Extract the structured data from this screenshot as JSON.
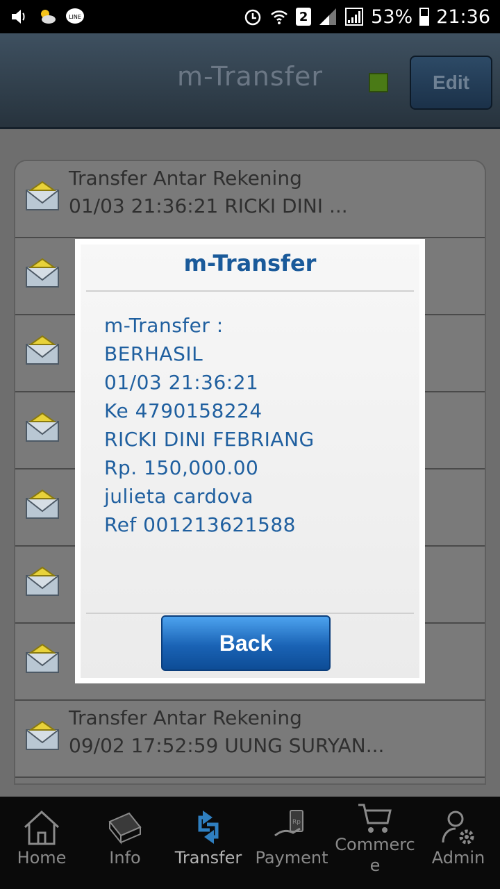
{
  "status_bar": {
    "sim_slot": "2",
    "battery": "53%",
    "time": "21:36",
    "icons": [
      "volume-icon",
      "weather-icon",
      "line-app-icon",
      "alarm-icon",
      "wifi-icon",
      "signal-icon",
      "battery-icon"
    ]
  },
  "header": {
    "title": "m-Transfer",
    "edit_label": "Edit",
    "status_color": "#4a7a16"
  },
  "list": {
    "items": [
      {
        "title": "Transfer Antar Rekening",
        "subtitle": "01/03 21:36:21 RICKI DINI ..."
      },
      {
        "title": "",
        "subtitle": ""
      },
      {
        "title": "",
        "subtitle": ""
      },
      {
        "title": "",
        "subtitle": ""
      },
      {
        "title": "",
        "subtitle": ""
      },
      {
        "title": "",
        "subtitle": ""
      },
      {
        "title": "",
        "subtitle": ""
      },
      {
        "title": "Transfer Antar Rekening",
        "subtitle": "09/02 17:52:59 UUNG SURYAN..."
      }
    ]
  },
  "dialog": {
    "title": "m-Transfer",
    "lines": [
      "m-Transfer :",
      "BERHASIL",
      "01/03 21:36:21",
      "Ke 4790158224",
      "RICKI DINI FEBRIANG",
      "Rp. 150,000.00",
      "julieta cardova",
      "Ref 001213621588"
    ],
    "back_label": "Back"
  },
  "bottom_nav": {
    "items": [
      {
        "label": "Home",
        "icon": "home-icon"
      },
      {
        "label": "Info",
        "icon": "info-book-icon"
      },
      {
        "label": "Transfer",
        "icon": "transfer-icon"
      },
      {
        "label": "Payment",
        "icon": "payment-icon"
      },
      {
        "label": "Commerc\ne",
        "icon": "cart-icon"
      },
      {
        "label": "Admin",
        "icon": "admin-icon"
      }
    ],
    "active": "Transfer"
  },
  "colors": {
    "header_bg": "#2c3a46",
    "dialog_text": "#1f5f9f",
    "back_button": "#1a63b5"
  }
}
